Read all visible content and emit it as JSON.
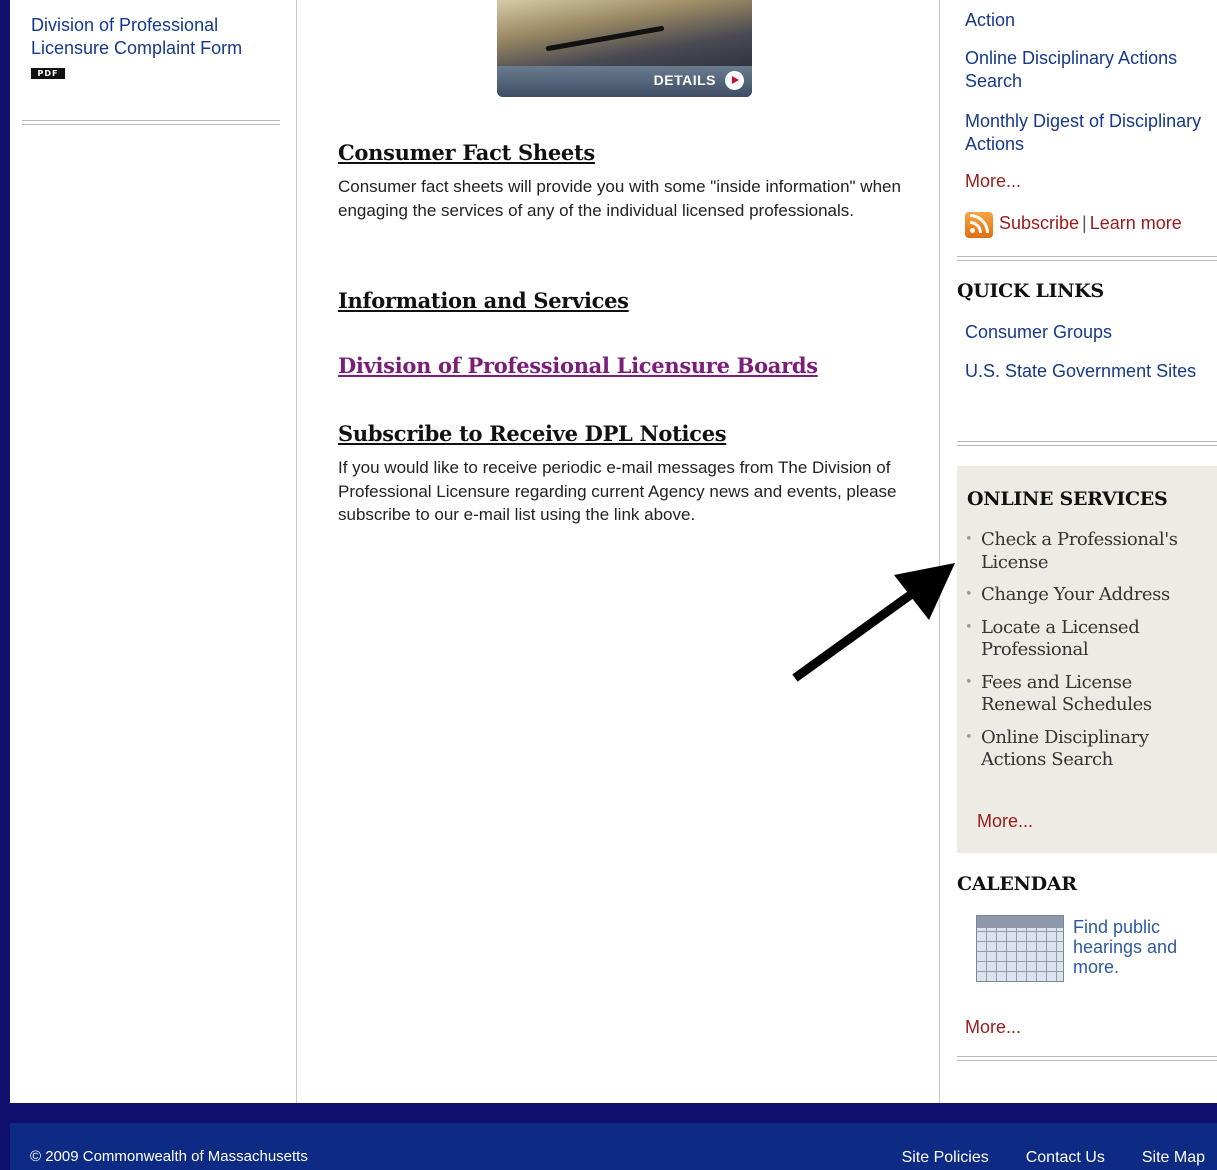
{
  "left": {
    "complaint_link": "Division of Professional Licensure Complaint Form",
    "pdf_badge": "PDF"
  },
  "feature": {
    "details_label": "DETAILS"
  },
  "main": {
    "fact_heading": "Consumer Fact Sheets",
    "fact_text": "Consumer fact sheets will provide you with some \"inside information\" when engaging the services of any of the individual licensed professionals.",
    "info_heading": "Information and Services",
    "boards_link": "Division of Professional Licensure Boards",
    "subscribe_heading": "Subscribe to Receive DPL Notices",
    "subscribe_text": "If you would like to receive periodic e-mail messages from The Division of Professional Licensure regarding current Agency news and events, please subscribe to our e-mail list using the link above."
  },
  "right": {
    "top_links": [
      "Action",
      "Online Disciplinary Actions Search",
      "Monthly Digest of Disciplinary Actions"
    ],
    "top_more": "More...",
    "subscribe": "Subscribe",
    "separator": "|",
    "learn_more": "Learn more",
    "quick_links_heading": "QUICK LINKS",
    "quick_links": [
      "Consumer Groups",
      "U.S. State Government Sites"
    ],
    "online_services_heading": "ONLINE SERVICES",
    "online_services": [
      "Check a Professional's License",
      "Change Your Address",
      "Locate a Licensed Professional",
      "Fees and License Renewal Schedules",
      "Online Disciplinary Actions Search"
    ],
    "online_more": "More...",
    "calendar_heading": "CALENDAR",
    "calendar_text": "Find public hearings and more.",
    "calendar_more": "More..."
  },
  "footer": {
    "copyright": "© 2009 Commonwealth of Massachusetts",
    "links": [
      "Site Policies",
      "Contact Us",
      "Site Map"
    ]
  },
  "colors": {
    "frame": "#0f0f6e",
    "footer": "#0d2a85",
    "link_blue": "#15398c",
    "more_red": "#9c1a1a",
    "visited_purple": "#7a1e79",
    "online_box": "#edebe3"
  },
  "icons": [
    "pdf-icon",
    "play-icon",
    "rss-icon",
    "calendar-icon",
    "arrow-annotation"
  ]
}
